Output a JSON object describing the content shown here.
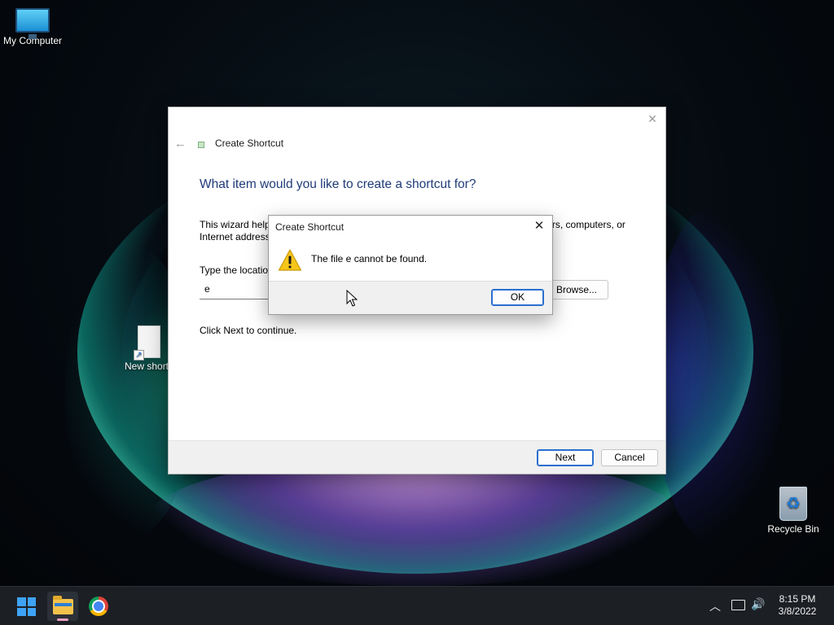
{
  "desktop": {
    "icons": {
      "my_computer": "My Computer",
      "new_shortcut": "New shortcut",
      "recycle_bin": "Recycle Bin"
    }
  },
  "wizard": {
    "title": "Create Shortcut",
    "heading": "What item would you like to create a shortcut for?",
    "description": "This wizard helps you to create shortcuts to local or network programs, files, folders, computers, or Internet addresses.",
    "location_label": "Type the location of the item:",
    "location_value": "e",
    "browse_label": "Browse...",
    "continue_text": "Click Next to continue.",
    "next_label": "Next",
    "cancel_label": "Cancel"
  },
  "error_dialog": {
    "title": "Create Shortcut",
    "message": "The file e cannot be found.",
    "ok_label": "OK",
    "icon": "warning-icon"
  },
  "taskbar": {
    "pinned": [
      "start-icon",
      "file-explorer-icon",
      "chrome-icon"
    ],
    "clock": {
      "time": "8:15 PM",
      "date": "3/8/2022"
    }
  },
  "colors": {
    "heading_blue": "#1f3b78",
    "accent_blue": "#2a6fcf",
    "taskbar_bg": "#1c1f24"
  }
}
